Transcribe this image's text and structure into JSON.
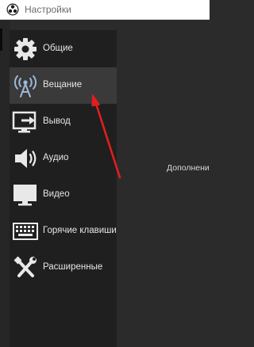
{
  "window": {
    "title": "Настройки",
    "app_icon": "obs-logo-icon"
  },
  "sidebar": {
    "selected_index": 1,
    "items": [
      {
        "label": "Общие",
        "icon": "gear-icon"
      },
      {
        "label": "Вещание",
        "icon": "broadcast-antenna-icon"
      },
      {
        "label": "Вывод",
        "icon": "output-monitor-icon"
      },
      {
        "label": "Аудио",
        "icon": "speaker-icon"
      },
      {
        "label": "Видео",
        "icon": "monitor-icon"
      },
      {
        "label": "Горячие клавиши",
        "icon": "keyboard-icon"
      },
      {
        "label": "Расширенные",
        "icon": "tools-icon"
      }
    ]
  },
  "content": {
    "partial_label": "Дополнени"
  },
  "colors": {
    "annotation_arrow": "#e01e1e",
    "selected_item": "#3a3a3a",
    "sidebar_bg": "#1f1f1f",
    "window_bg": "#2b2b2b"
  }
}
